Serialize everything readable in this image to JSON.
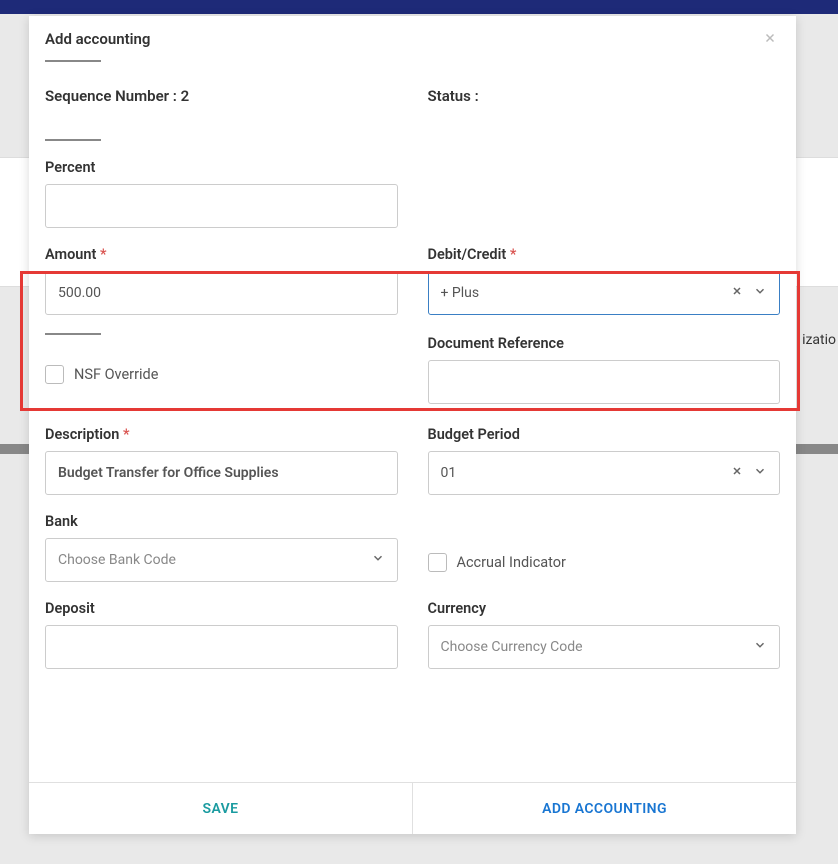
{
  "modal": {
    "title": "Add accounting",
    "sequenceLabel": "Sequence Number : 2",
    "statusLabel": "Status :"
  },
  "fields": {
    "percent": {
      "label": "Percent",
      "value": ""
    },
    "amount": {
      "label": "Amount",
      "value": "500.00"
    },
    "debitCredit": {
      "label": "Debit/Credit",
      "value": "+ Plus"
    },
    "nsfOverride": {
      "label": "NSF Override"
    },
    "docRef": {
      "label": "Document Reference",
      "value": ""
    },
    "description": {
      "label": "Description",
      "value": "Budget Transfer for Office Supplies"
    },
    "budgetPeriod": {
      "label": "Budget Period",
      "value": "01"
    },
    "bank": {
      "label": "Bank",
      "placeholder": "Choose Bank Code"
    },
    "accrual": {
      "label": "Accrual Indicator"
    },
    "deposit": {
      "label": "Deposit",
      "value": ""
    },
    "currency": {
      "label": "Currency",
      "placeholder": "Choose Currency Code"
    }
  },
  "footer": {
    "save": "SAVE",
    "addAccounting": "ADD ACCOUNTING"
  },
  "background": {
    "rightText": "izatio"
  }
}
